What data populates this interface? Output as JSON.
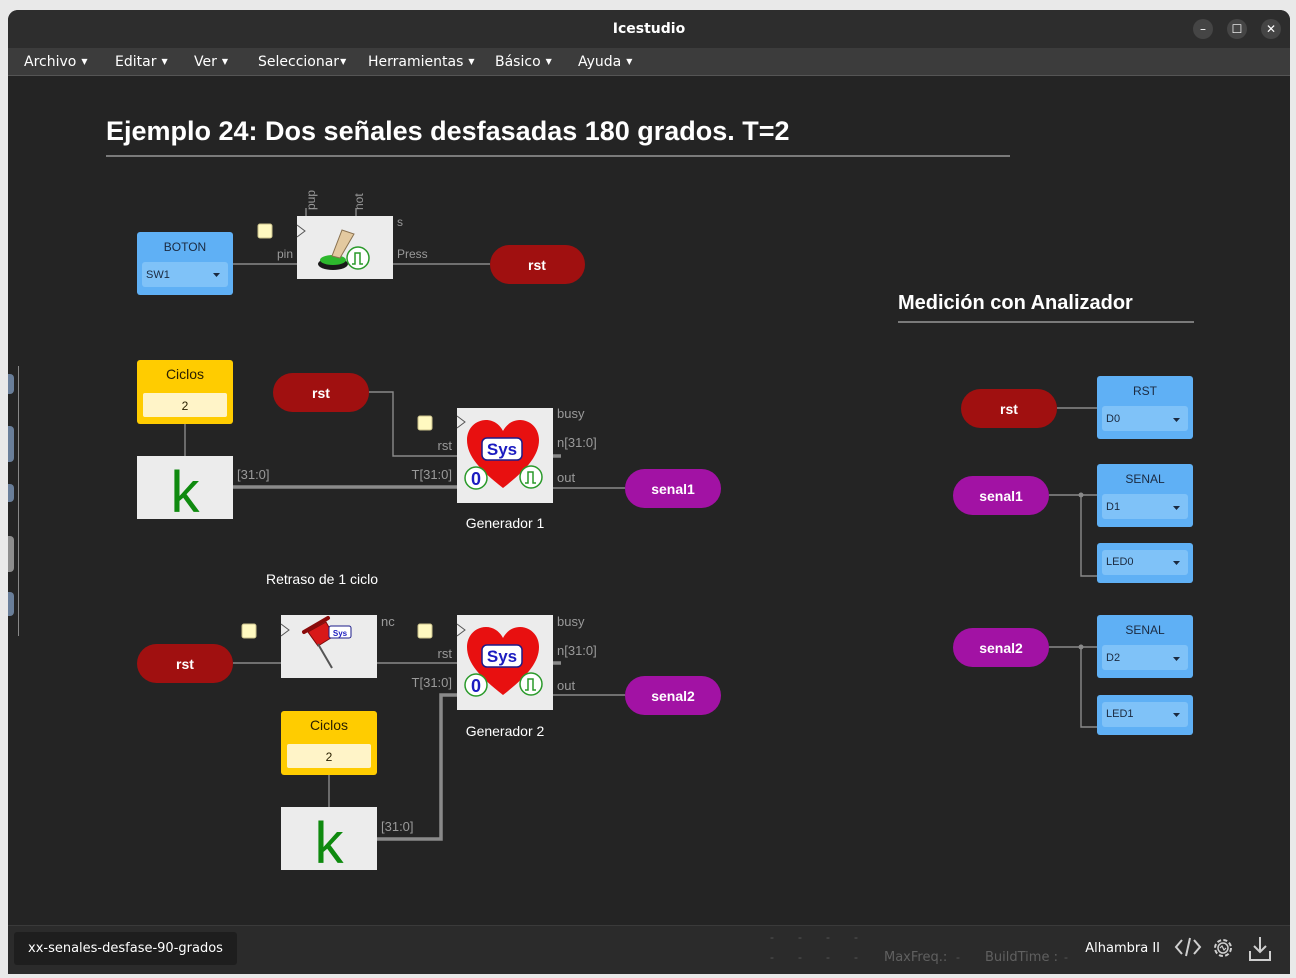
{
  "window": {
    "title": "Icestudio",
    "controls": {
      "minimize": "–",
      "maximize": "☐",
      "close": "✕"
    }
  },
  "menu": [
    {
      "label": "Archivo"
    },
    {
      "label": "Editar"
    },
    {
      "label": "Ver"
    },
    {
      "label": "Seleccionar"
    },
    {
      "label": "Herramientas"
    },
    {
      "label": "Básico"
    },
    {
      "label": "Ayuda"
    }
  ],
  "canvas": {
    "title": "Ejemplo 24: Dos señales desfasadas 180 grados. T=2",
    "subtitle": "Medición con Analizador",
    "comment_delay": "Retraso de 1 ciclo",
    "boton_block": {
      "header": "BOTON",
      "value": "SW1"
    },
    "button_ports": {
      "pin": "pin",
      "pup": "pup",
      "not": "not",
      "s": "s",
      "press": "Press"
    },
    "ciclos1": {
      "header": "Ciclos",
      "value": "2"
    },
    "ciclos2": {
      "header": "Ciclos",
      "value": "2"
    },
    "k_label": "k",
    "bus_label": "[31:0]",
    "gen_ports": {
      "rst": "rst",
      "t": "T[31:0]",
      "busy": "busy",
      "n": "n[31:0]",
      "out": "out"
    },
    "sys_label": "Sys",
    "zero_label": "0",
    "generador1": "Generador 1",
    "generador2": "Generador 2",
    "delay_ports": {
      "nc": "nc",
      "sys": "Sys"
    },
    "labels": {
      "rst": "rst",
      "senal1": "senal1",
      "senal2": "senal2"
    },
    "analyzer": {
      "rst": {
        "header": "RST",
        "value": "D0"
      },
      "senal1": {
        "header": "SENAL",
        "value": "D1"
      },
      "led0": {
        "value": "LED0"
      },
      "senal2": {
        "header": "SENAL",
        "value": "D2"
      },
      "led1": {
        "value": "LED1"
      }
    }
  },
  "status": {
    "filename": "xx-senales-desfase-90-grados",
    "maxfreq": "MaxFreq.:",
    "buildtime": "BuildTime :",
    "dash": "-",
    "board": "Alhambra II"
  },
  "colors": {
    "label_red": "#a01010",
    "label_purple": "#a212a4",
    "io_blue": "#5fb0f5",
    "const_yellow": "#ffcc00",
    "k_green": "#0f8a0f"
  }
}
